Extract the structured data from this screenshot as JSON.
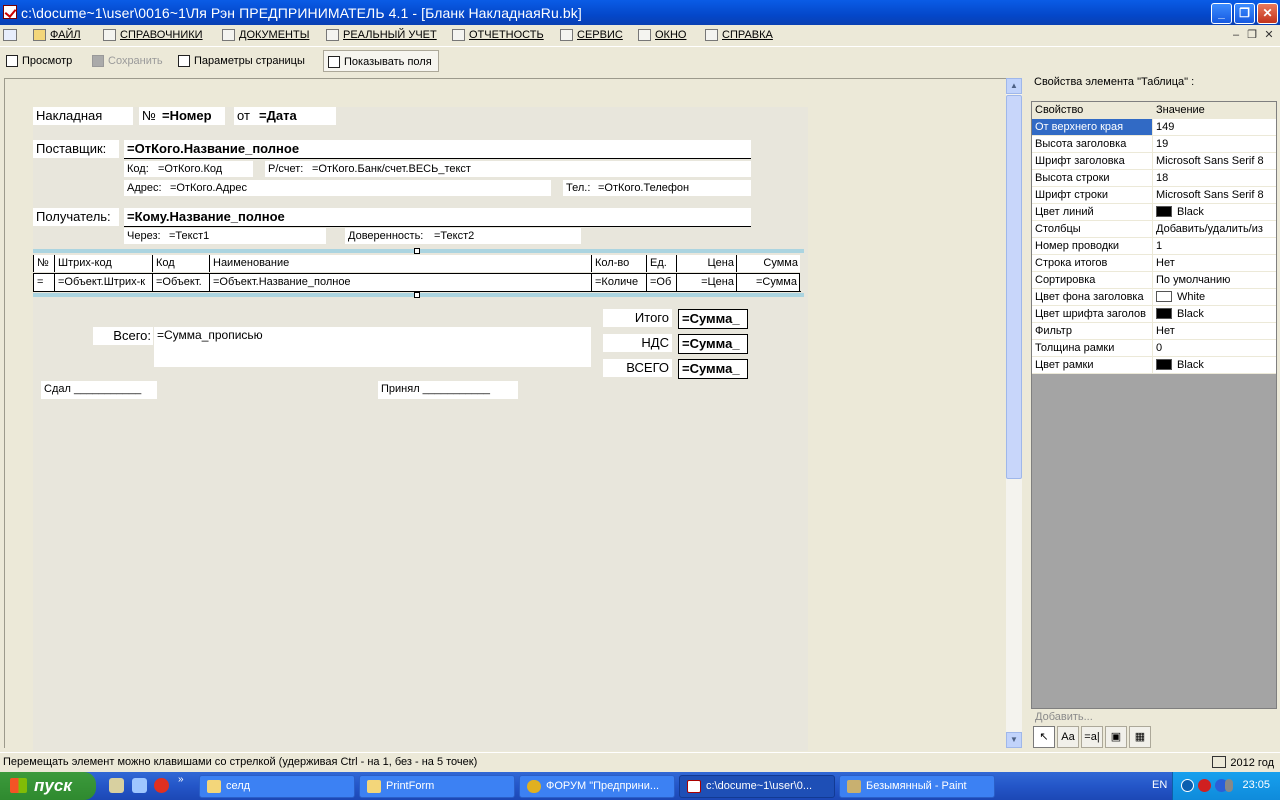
{
  "window": {
    "title": "c:\\docume~1\\user\\0016~1\\Ля Рэн  ПРЕДПРИНИМАТЕЛЬ 4.1 - [Бланк  НакладнаяRu.bk]"
  },
  "menu": {
    "items": [
      {
        "label": "ФАЙЛ",
        "icon": "folder-icon"
      },
      {
        "label": "СПРАВОЧНИКИ",
        "icon": "house-icon"
      },
      {
        "label": "ДОКУМЕНТЫ",
        "icon": "document-icon"
      },
      {
        "label": "РЕАЛЬНЫЙ УЧЕТ",
        "icon": "ledger-icon"
      },
      {
        "label": "ОТЧЕТНОСТЬ",
        "icon": "report-icon"
      },
      {
        "label": "СЕРВИС",
        "icon": "service-icon"
      },
      {
        "label": "ОКНО",
        "icon": "window-icon"
      },
      {
        "label": "СПРАВКА",
        "icon": "help-icon"
      }
    ]
  },
  "toolbar": {
    "preview": "Просмотр",
    "save": "Сохранить",
    "page_params": "Параметры страницы",
    "show_fields": "Показывать поля"
  },
  "form": {
    "invoice_label": "Накладная",
    "number_sign": "№",
    "number_field": "=Номер",
    "from_label": "от",
    "date_field": "=Дата",
    "supplier_label": "Поставщик:",
    "supplier_name": "=ОтКого.Название_полное",
    "code_label": "Код:",
    "code_field": "=ОтКого.Код",
    "account_label": "Р/счет:",
    "account_field": "=ОтКого.Банк/счет.ВЕСЬ_текст",
    "address_label": "Адрес:",
    "address_field": "=ОтКого.Адрес",
    "phone_label": "Тел.:",
    "phone_field": "=ОтКого.Телефон",
    "receiver_label": "Получатель:",
    "receiver_name": "=Кому.Название_полное",
    "via_label": "Через:",
    "via_field": "=Текст1",
    "proxy_label": "Доверенность:",
    "proxy_field": "=Текст2",
    "total_words_label": "Всего:",
    "total_words_field": "=Сумма_прописью",
    "itogo_label": "Итого",
    "itogo_field": "=Сумма_",
    "nds_label": "НДС",
    "nds_field": "=Сумма_",
    "vsego_label": "ВСЕГО",
    "vsego_field": "=Сумма_",
    "handed_label": "Сдал ___________",
    "received_label": "Принял  ___________"
  },
  "table": {
    "headers": [
      "№",
      "Штрих-код",
      "Код",
      "Наименование",
      "Кол-во",
      "Ед.",
      "Цена",
      "Сумма"
    ],
    "row": [
      "=",
      "=Объект.Штрих-к",
      "=Объект.",
      "=Объект.Название_полное",
      "=Количе",
      "=Об",
      "=Цена",
      "=Сумма"
    ]
  },
  "properties": {
    "header": "Свойства элемента \"Таблица\" :",
    "col_property": "Свойство",
    "col_value": "Значение",
    "rows": [
      {
        "key": "От верхнего края",
        "value": "149",
        "selected": true
      },
      {
        "key": "Высота заголовка",
        "value": "19"
      },
      {
        "key": "Шрифт заголовка",
        "value": "Microsoft Sans Serif 8"
      },
      {
        "key": "Высота строки",
        "value": "18"
      },
      {
        "key": "Шрифт строки",
        "value": "Microsoft Sans Serif 8"
      },
      {
        "key": "Цвет линий",
        "value": "Black",
        "swatch": "#000000"
      },
      {
        "key": "Столбцы",
        "value": "Добавить/удалить/из"
      },
      {
        "key": "Номер проводки",
        "value": "1"
      },
      {
        "key": "Строка итогов",
        "value": "Нет"
      },
      {
        "key": "Сортировка",
        "value": "По умолчанию"
      },
      {
        "key": "Цвет фона заголовка",
        "value": "White",
        "swatch": "#ffffff"
      },
      {
        "key": "Цвет шрифта заголов",
        "value": "Black",
        "swatch": "#000000"
      },
      {
        "key": "Фильтр",
        "value": "Нет"
      },
      {
        "key": "Толщина рамки",
        "value": "0"
      },
      {
        "key": "Цвет рамки",
        "value": "Black",
        "swatch": "#000000"
      }
    ]
  },
  "add_label": "Добавить...",
  "tools": [
    {
      "name": "pointer-tool",
      "glyph": "↖"
    },
    {
      "name": "text-tool",
      "glyph": "Aa"
    },
    {
      "name": "field-tool",
      "glyph": "=a|"
    },
    {
      "name": "image-tool",
      "glyph": "▣"
    },
    {
      "name": "table-tool",
      "glyph": "▦"
    }
  ],
  "status": {
    "message": "Перемещать элемент можно клавишами со стрелкой (удерживая Ctrl - на 1, без - на 5 точек)",
    "year": "2012 год"
  },
  "taskbar": {
    "start": "пуск",
    "tasks": [
      {
        "label": "селд",
        "icon": "folder-icon"
      },
      {
        "label": "PrintForm",
        "icon": "folder-icon"
      },
      {
        "label": "ФОРУМ \"Предприни...",
        "icon": "chrome-icon"
      },
      {
        "label": "c:\\docume~1\\user\\0...",
        "icon": "app-icon",
        "active": true
      },
      {
        "label": "Безымянный - Paint",
        "icon": "paint-icon"
      }
    ],
    "lang": "EN",
    "clock": "23:05"
  }
}
